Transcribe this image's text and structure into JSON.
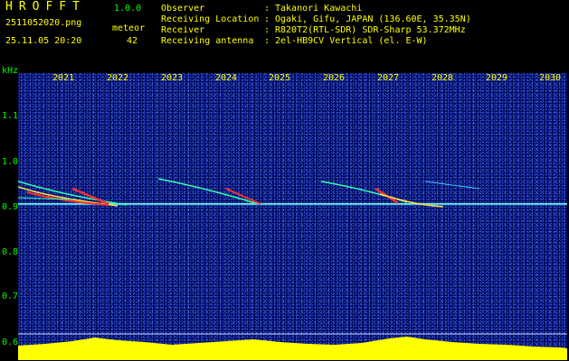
{
  "header": {
    "app_title": "HROFFT",
    "version": "1.0.0",
    "file_name": "2511052020.png",
    "meteor_label": "meteor",
    "date_time": "25.11.05 20:20",
    "meteor_count": "42"
  },
  "station": {
    "observer_label": "Observer",
    "observer": "Takanori Kawachi",
    "location_label": "Receiving Location",
    "location": "Ogaki, Gifu, JAPAN (136.60E, 35.35N)",
    "receiver_label": "Receiver",
    "receiver": "R820T2(RTL-SDR) SDR-Sharp 53.372MHz",
    "antenna_label": "Receiving antenna",
    "antenna": "2el-HB9CV Vertical (el. E-W)",
    "separator": ":"
  },
  "axes": {
    "y_unit": "kHz",
    "x_ticks": [
      "2021",
      "2022",
      "2023",
      "2024",
      "2025",
      "2026",
      "2027",
      "2028",
      "2029",
      "2030"
    ],
    "y_ticks": [
      "1.1",
      "1.0",
      "0.9",
      "0.8",
      "0.7",
      "0.6"
    ],
    "y_range": [
      0.58,
      1.2
    ]
  },
  "colors": {
    "background": "#000000",
    "header_text": "#ffff00",
    "axis_text": "#00ff00",
    "spectrogram_bg": "#000a55",
    "carrier_line": "#7dffd8",
    "meteor_track": "#ff3030",
    "histogram": "#ffff00"
  }
}
